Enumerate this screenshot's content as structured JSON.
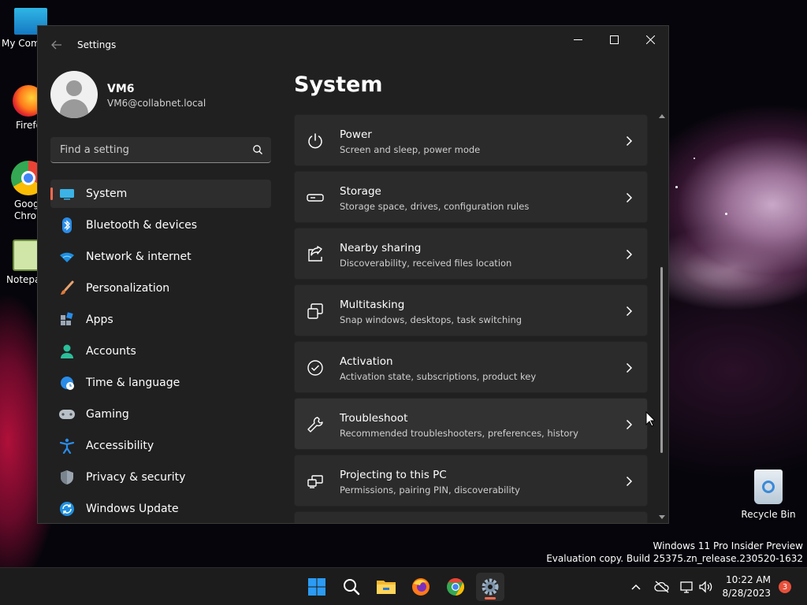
{
  "desktop": {
    "icons": [
      {
        "label": "My Com"
      },
      {
        "label": "Firefo"
      },
      {
        "label": "Goog Chron"
      },
      {
        "label": "Notepa"
      },
      {
        "label": "Recycle Bin"
      }
    ],
    "watermark_line1": "Windows 11 Pro Insider Preview",
    "watermark_line2": "Evaluation copy. Build 25375.zn_release.230520-1632"
  },
  "window": {
    "title": "Settings",
    "profile": {
      "name": "VM6",
      "email": "VM6@collabnet.local"
    },
    "search": {
      "placeholder": "Find a setting",
      "value": ""
    },
    "nav": [
      {
        "label": "System",
        "icon": "system-icon",
        "selected": true
      },
      {
        "label": "Bluetooth & devices",
        "icon": "bluetooth-icon"
      },
      {
        "label": "Network & internet",
        "icon": "wifi-icon"
      },
      {
        "label": "Personalization",
        "icon": "brush-icon"
      },
      {
        "label": "Apps",
        "icon": "apps-icon"
      },
      {
        "label": "Accounts",
        "icon": "person-icon"
      },
      {
        "label": "Time & language",
        "icon": "globe-clock-icon"
      },
      {
        "label": "Gaming",
        "icon": "gamepad-icon"
      },
      {
        "label": "Accessibility",
        "icon": "accessibility-icon"
      },
      {
        "label": "Privacy & security",
        "icon": "shield-icon"
      },
      {
        "label": "Windows Update",
        "icon": "update-icon"
      }
    ],
    "page_title": "System",
    "cards": [
      {
        "title": "Power",
        "subtitle": "Screen and sleep, power mode",
        "icon": "power-icon"
      },
      {
        "title": "Storage",
        "subtitle": "Storage space, drives, configuration rules",
        "icon": "storage-icon"
      },
      {
        "title": "Nearby sharing",
        "subtitle": "Discoverability, received files location",
        "icon": "share-icon"
      },
      {
        "title": "Multitasking",
        "subtitle": "Snap windows, desktops, task switching",
        "icon": "multitask-icon"
      },
      {
        "title": "Activation",
        "subtitle": "Activation state, subscriptions, product key",
        "icon": "check-circle-icon"
      },
      {
        "title": "Troubleshoot",
        "subtitle": "Recommended troubleshooters, preferences, history",
        "icon": "wrench-icon"
      },
      {
        "title": "Projecting to this PC",
        "subtitle": "Permissions, pairing PIN, discoverability",
        "icon": "project-icon"
      }
    ]
  },
  "taskbar": {
    "apps": [
      "start-icon",
      "search-icon",
      "file-explorer-icon",
      "firefox-icon",
      "chrome-icon",
      "settings-icon"
    ],
    "time": "10:22 AM",
    "date": "8/28/2023",
    "notification_count": "3"
  },
  "colors": {
    "accent": "#ff6a4d",
    "window_bg": "#202020",
    "card_bg": "#2b2b2b",
    "taskbar_bg": "#1c1c1c"
  }
}
